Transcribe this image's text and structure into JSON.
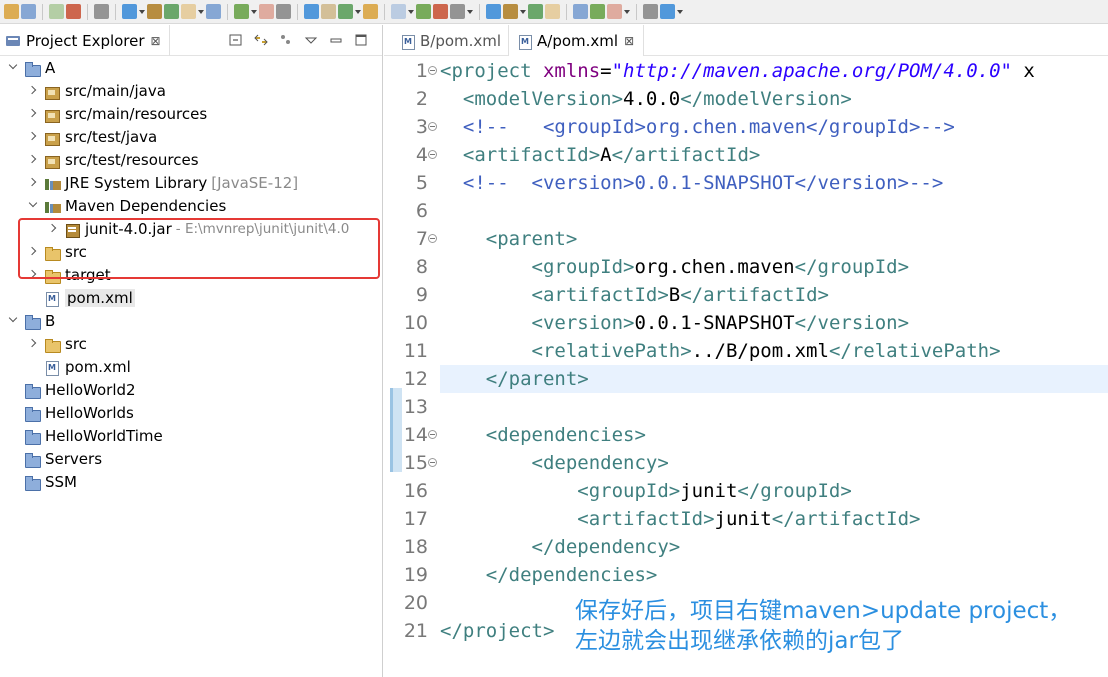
{
  "toolbar": {
    "icons": [
      "new-icon",
      "save-icon",
      "print-icon",
      "debug-icon",
      "run-icon",
      "build-icon",
      "search-icon",
      "perspective-icon"
    ]
  },
  "explorer": {
    "title": "Project Explorer",
    "close": "⊠",
    "tree": [
      {
        "label": "A",
        "decoration": "",
        "indent": 0,
        "expand": "down",
        "icon": "project"
      },
      {
        "label": "src/main/java",
        "decoration": "",
        "indent": 1,
        "expand": "right",
        "icon": "pkg"
      },
      {
        "label": "src/main/resources",
        "decoration": "",
        "indent": 1,
        "expand": "right",
        "icon": "pkg"
      },
      {
        "label": "src/test/java",
        "decoration": "",
        "indent": 1,
        "expand": "right",
        "icon": "pkg"
      },
      {
        "label": "src/test/resources",
        "decoration": "",
        "indent": 1,
        "expand": "right",
        "icon": "pkg"
      },
      {
        "label": "JRE System Library",
        "decoration": "[JavaSE-12]",
        "indent": 1,
        "expand": "right",
        "icon": "lib"
      },
      {
        "label": "Maven Dependencies",
        "decoration": "",
        "indent": 1,
        "expand": "down",
        "icon": "lib"
      },
      {
        "label": "junit-4.0.jar",
        "decoration": "- E:\\mvnrep\\junit\\junit\\4.0",
        "indent": 2,
        "expand": "right",
        "icon": "jar"
      },
      {
        "label": "src",
        "decoration": "",
        "indent": 1,
        "expand": "right",
        "icon": "folder"
      },
      {
        "label": "target",
        "decoration": "",
        "indent": 1,
        "expand": "right",
        "icon": "folder"
      },
      {
        "label": "pom.xml",
        "decoration": "",
        "indent": 1,
        "expand": "none",
        "icon": "xml",
        "selected": true
      },
      {
        "label": "B",
        "decoration": "",
        "indent": 0,
        "expand": "down",
        "icon": "project"
      },
      {
        "label": "src",
        "decoration": "",
        "indent": 1,
        "expand": "right",
        "icon": "folder"
      },
      {
        "label": "pom.xml",
        "decoration": "",
        "indent": 1,
        "expand": "none",
        "icon": "xml"
      },
      {
        "label": "HelloWorld2",
        "decoration": "",
        "indent": 0,
        "expand": "none",
        "icon": "project"
      },
      {
        "label": "HelloWorlds",
        "decoration": "",
        "indent": 0,
        "expand": "none",
        "icon": "project"
      },
      {
        "label": "HelloWorldTime",
        "decoration": "",
        "indent": 0,
        "expand": "none",
        "icon": "project"
      },
      {
        "label": "Servers",
        "decoration": "",
        "indent": 0,
        "expand": "none",
        "icon": "project"
      },
      {
        "label": "SSM",
        "decoration": "",
        "indent": 0,
        "expand": "none",
        "icon": "project"
      }
    ]
  },
  "editor": {
    "tabs": [
      {
        "label": "B/pom.xml",
        "active": false
      },
      {
        "label": "A/pom.xml",
        "active": true
      }
    ],
    "close": "⊠",
    "current_line": 12,
    "lines": [
      {
        "n": "1",
        "fold": true,
        "parts": [
          [
            "tag",
            "<project "
          ],
          [
            "attr",
            "xmlns"
          ],
          [
            "plain",
            "="
          ],
          [
            "val",
            "\"http://maven.apache.org/POM/4.0.0\""
          ],
          [
            "plain",
            " x"
          ]
        ]
      },
      {
        "n": "2",
        "fold": false,
        "parts": [
          [
            "tag",
            "  <modelVersion>"
          ],
          [
            "plain",
            "4.0.0"
          ],
          [
            "tag",
            "</modelVersion>"
          ]
        ]
      },
      {
        "n": "3",
        "fold": true,
        "parts": [
          [
            "cmt",
            "  <!--   <groupId>org.chen.maven</groupId>-->"
          ]
        ]
      },
      {
        "n": "4",
        "fold": true,
        "parts": [
          [
            "tag",
            "  <artifactId>"
          ],
          [
            "plain",
            "A"
          ],
          [
            "tag",
            "</artifactId>"
          ]
        ]
      },
      {
        "n": "5",
        "fold": false,
        "parts": [
          [
            "cmt",
            "  <!--  <version>0.0.1-SNAPSHOT</version>-->"
          ]
        ]
      },
      {
        "n": "6",
        "fold": false,
        "parts": [
          [
            "plain",
            " "
          ]
        ]
      },
      {
        "n": "7",
        "fold": true,
        "parts": [
          [
            "tag",
            "    <parent>"
          ]
        ]
      },
      {
        "n": "8",
        "fold": false,
        "parts": [
          [
            "tag",
            "        <groupId>"
          ],
          [
            "plain",
            "org.chen.maven"
          ],
          [
            "tag",
            "</groupId>"
          ]
        ]
      },
      {
        "n": "9",
        "fold": false,
        "parts": [
          [
            "tag",
            "        <artifactId>"
          ],
          [
            "plain",
            "B"
          ],
          [
            "tag",
            "</artifactId>"
          ]
        ]
      },
      {
        "n": "10",
        "fold": false,
        "parts": [
          [
            "tag",
            "        <version>"
          ],
          [
            "plain",
            "0.0.1-SNAPSHOT"
          ],
          [
            "tag",
            "</version>"
          ]
        ]
      },
      {
        "n": "11",
        "fold": false,
        "parts": [
          [
            "tag",
            "        <relativePath>"
          ],
          [
            "plain",
            "../B/pom.xml"
          ],
          [
            "tag",
            "</relativePath>"
          ]
        ]
      },
      {
        "n": "12",
        "fold": false,
        "parts": [
          [
            "tag",
            "    </parent>"
          ]
        ]
      },
      {
        "n": "13",
        "fold": false,
        "parts": [
          [
            "plain",
            " "
          ]
        ]
      },
      {
        "n": "14",
        "fold": true,
        "parts": [
          [
            "tag",
            "    <dependencies>"
          ]
        ]
      },
      {
        "n": "15",
        "fold": true,
        "parts": [
          [
            "tag",
            "        <dependency>"
          ]
        ]
      },
      {
        "n": "16",
        "fold": false,
        "parts": [
          [
            "tag",
            "            <groupId>"
          ],
          [
            "plain",
            "junit"
          ],
          [
            "tag",
            "</groupId>"
          ]
        ]
      },
      {
        "n": "17",
        "fold": false,
        "parts": [
          [
            "tag",
            "            <artifactId>"
          ],
          [
            "plain",
            "junit"
          ],
          [
            "tag",
            "</artifactId>"
          ]
        ]
      },
      {
        "n": "18",
        "fold": false,
        "parts": [
          [
            "tag",
            "        </dependency>"
          ]
        ]
      },
      {
        "n": "19",
        "fold": false,
        "parts": [
          [
            "tag",
            "    </dependencies>"
          ]
        ]
      },
      {
        "n": "20",
        "fold": false,
        "parts": [
          [
            "plain",
            " "
          ]
        ]
      },
      {
        "n": "21",
        "fold": false,
        "parts": [
          [
            "tag",
            "</project>"
          ]
        ]
      }
    ]
  },
  "annotation": {
    "line1": "保存好后，项目右键maven>update project，",
    "line2": "左边就会出现继承依赖的jar包了"
  },
  "colors": {
    "highlight": "#e53935",
    "annotation": "#2b8fe0",
    "tag": "#3f7f7f",
    "attribute": "#7f007f",
    "value": "#2a00ff",
    "comment": "#3f5fbf"
  }
}
